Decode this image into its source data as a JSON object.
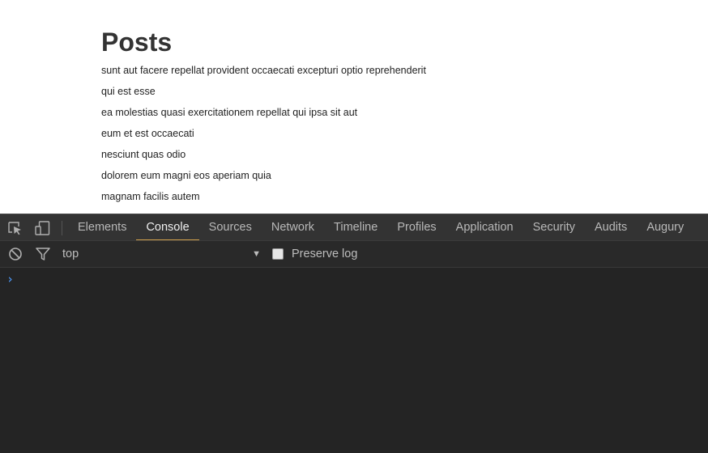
{
  "page": {
    "title": "Posts",
    "posts": [
      "sunt aut facere repellat provident occaecati excepturi optio reprehenderit",
      "qui est esse",
      "ea molestias quasi exercitationem repellat qui ipsa sit aut",
      "eum et est occaecati",
      "nesciunt quas odio",
      "dolorem eum magni eos aperiam quia",
      "magnam facilis autem"
    ]
  },
  "devtools": {
    "tabs": [
      "Elements",
      "Console",
      "Sources",
      "Network",
      "Timeline",
      "Profiles",
      "Application",
      "Security",
      "Audits",
      "Augury"
    ],
    "active_tab": "Console",
    "toolbar_icons": [
      "inspect-element-icon",
      "device-toolbar-icon"
    ],
    "console_bar": {
      "context": "top",
      "preserve_log_label": "Preserve log",
      "preserve_log_checked": false,
      "icons": [
        "clear-console-icon",
        "filter-icon",
        "dropdown-arrow-icon"
      ]
    },
    "prompt_symbol": "›"
  },
  "colors": {
    "devtools_bg": "#242424",
    "tabbar_bg": "#333333",
    "active_tab_underline": "#d4a24c",
    "prompt_blue": "#4a8fe7"
  }
}
